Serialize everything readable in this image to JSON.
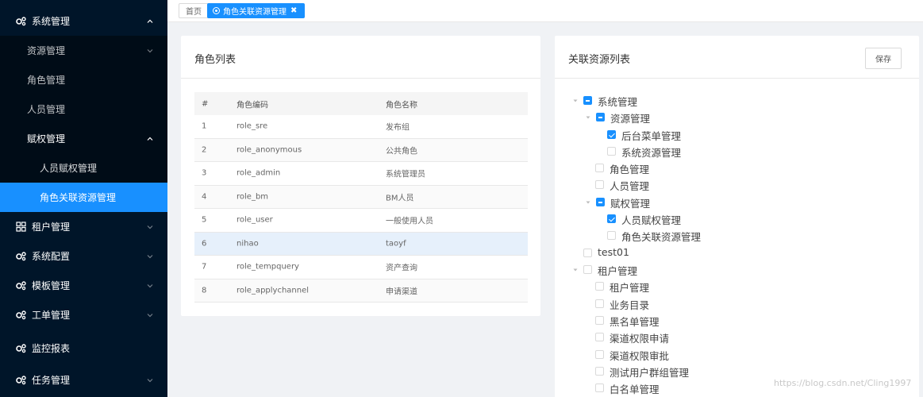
{
  "sidebar": {
    "items": [
      {
        "label": "系统管理",
        "icon": "gear-icon",
        "arrow": "up"
      },
      {
        "label": "资源管理",
        "arrow": "down"
      },
      {
        "label": "角色管理"
      },
      {
        "label": "人员管理"
      },
      {
        "label": "赋权管理",
        "arrow": "up"
      },
      {
        "label": "人员赋权管理"
      },
      {
        "label": "角色关联资源管理"
      },
      {
        "label": "租户管理",
        "icon": "grid-icon",
        "arrow": "down"
      },
      {
        "label": "系统配置",
        "icon": "gear-icon",
        "arrow": "down"
      },
      {
        "label": "模板管理",
        "icon": "gear-icon",
        "arrow": "down"
      },
      {
        "label": "工单管理",
        "icon": "gear-icon",
        "arrow": "down"
      },
      {
        "label": "监控报表",
        "icon": "gear-icon"
      },
      {
        "label": "任务管理",
        "icon": "gear-icon",
        "arrow": "down"
      }
    ]
  },
  "tabs": {
    "home": "首页",
    "active": "角色关联资源管理",
    "close": "✖"
  },
  "role_card": {
    "title": "角色列表",
    "columns": [
      "#",
      "角色编码",
      "角色名称"
    ],
    "rows": [
      [
        "1",
        "role_sre",
        "发布组"
      ],
      [
        "2",
        "role_anonymous",
        "公共角色"
      ],
      [
        "3",
        "role_admin",
        "系统管理员"
      ],
      [
        "4",
        "role_bm",
        "BM人员"
      ],
      [
        "5",
        "role_user",
        "一般使用人员"
      ],
      [
        "6",
        "nihao",
        "taoyf"
      ],
      [
        "7",
        "role_tempquery",
        "资产查询"
      ],
      [
        "8",
        "role_applychannel",
        "申请渠道"
      ]
    ]
  },
  "resource_card": {
    "title": "关联资源列表",
    "save_label": "保存",
    "tree": [
      {
        "label": "系统管理",
        "state": "indeterminate",
        "expanded": true
      },
      {
        "label": "资源管理",
        "state": "indeterminate",
        "expanded": true
      },
      {
        "label": "后台菜单管理",
        "state": "checked"
      },
      {
        "label": "系统资源管理",
        "state": "unchecked"
      },
      {
        "label": "角色管理",
        "state": "unchecked"
      },
      {
        "label": "人员管理",
        "state": "unchecked"
      },
      {
        "label": "赋权管理",
        "state": "indeterminate",
        "expanded": true
      },
      {
        "label": "人员赋权管理",
        "state": "checked"
      },
      {
        "label": "角色关联资源管理",
        "state": "unchecked"
      },
      {
        "label": "test01",
        "state": "unchecked"
      },
      {
        "label": "租户管理",
        "state": "unchecked",
        "expanded": true
      },
      {
        "label": "租户管理",
        "state": "unchecked"
      },
      {
        "label": "业务目录",
        "state": "unchecked"
      },
      {
        "label": "黑名单管理",
        "state": "unchecked"
      },
      {
        "label": "渠道权限申请",
        "state": "unchecked"
      },
      {
        "label": "渠道权限审批",
        "state": "unchecked"
      },
      {
        "label": "测试用户群组管理",
        "state": "unchecked"
      },
      {
        "label": "白名单管理",
        "state": "unchecked"
      }
    ]
  },
  "watermark": "https://blog.csdn.net/Cling1997",
  "colors": {
    "sidebar": "#001529",
    "accent": "#1890ff"
  }
}
